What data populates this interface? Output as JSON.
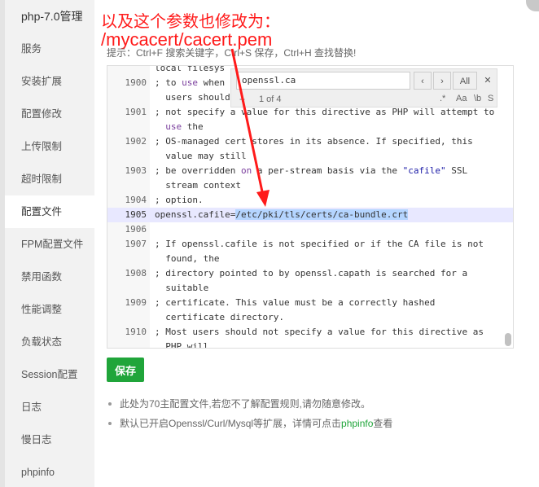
{
  "window": {
    "title": "php-7.0管理"
  },
  "sidebar": {
    "items": [
      {
        "label": "服务"
      },
      {
        "label": "安装扩展"
      },
      {
        "label": "配置修改"
      },
      {
        "label": "上传限制"
      },
      {
        "label": "超时限制"
      },
      {
        "label": "配置文件",
        "active": true
      },
      {
        "label": "FPM配置文件"
      },
      {
        "label": "禁用函数"
      },
      {
        "label": "性能调整"
      },
      {
        "label": "负载状态"
      },
      {
        "label": "Session配置"
      },
      {
        "label": "日志"
      },
      {
        "label": "慢日志"
      },
      {
        "label": "phpinfo"
      }
    ]
  },
  "annotation": {
    "line1": "以及这个参数也修改为：",
    "line2": "/mycacert/cacert.pem",
    "color": "#ff1a1a"
  },
  "hint": "提示：Ctrl+F 搜索关键字，Ctrl+S 保存，Ctrl+H 查找替换!",
  "editor": {
    "top_partial": "local filesys",
    "lines": [
      {
        "num": "1900",
        "text": "; to use when"
      },
      {
        "num": "",
        "text": "  users should"
      },
      {
        "num": "1901",
        "text": "; not specify a value for this directive as PHP will attempt to"
      },
      {
        "num": "",
        "text": "  use the"
      },
      {
        "num": "1902",
        "text": "; OS-managed cert stores in its absence. If specified, this"
      },
      {
        "num": "",
        "text": "  value may still"
      },
      {
        "num": "1903",
        "text": "; be overridden on a per-stream basis via the \"cafile\" SSL"
      },
      {
        "num": "",
        "text": "  stream context"
      },
      {
        "num": "1904",
        "text": "; option."
      },
      {
        "num": "1905",
        "text_before": "openssl.cafile=",
        "text_selected": "/etc/pki/tls/certs/ca-bundle.crt"
      },
      {
        "num": "1906",
        "text": ""
      },
      {
        "num": "1907",
        "text": "; If openssl.cafile is not specified or if the CA file is not"
      },
      {
        "num": "",
        "text": "  found, the"
      },
      {
        "num": "1908",
        "text": "; directory pointed to by openssl.capath is searched for a"
      },
      {
        "num": "",
        "text": "  suitable"
      },
      {
        "num": "1909",
        "text": "; certificate. This value must be a correctly hashed"
      },
      {
        "num": "",
        "text": "  certificate directory."
      },
      {
        "num": "1910",
        "text": "; Most users should not specify a value for this directive as"
      },
      {
        "num": "",
        "text": "  PHP will"
      }
    ]
  },
  "search": {
    "value": "openssl.ca",
    "prev": "‹",
    "next": "›",
    "all": "All",
    "close": "✕",
    "plus": "+",
    "count": "1 of 4",
    "opt_regex": ".*",
    "opt_case": "Aa",
    "opt_word": "\\b",
    "opt_selection": "S"
  },
  "save_button": "保存",
  "notes": {
    "n1": "此处为70主配置文件,若您不了解配置规则,请勿随意修改。",
    "n2_before": "默认已开启Openssl/Curl/Mysql等扩展，详情可点击",
    "n2_link": "phpinfo",
    "n2_after": "查看"
  },
  "colors": {
    "accent_green": "#20a53a",
    "selection": "#b5d5ff",
    "current_line": "#e8e8ff"
  }
}
